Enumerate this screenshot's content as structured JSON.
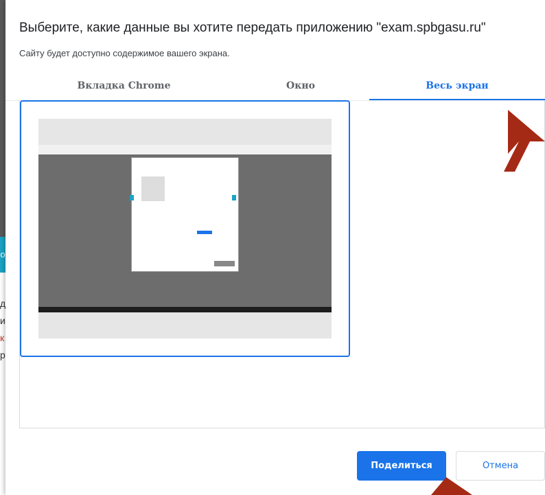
{
  "dialog": {
    "title": "Выберите, какие данные вы хотите передать приложению \"exam.spbgasu.ru\"",
    "subtitle": "Сайту будет доступно содержимое вашего экрана."
  },
  "tabs": [
    {
      "label": "Вкладка Chrome",
      "selected": false
    },
    {
      "label": "Окно",
      "selected": false
    },
    {
      "label": "Весь экран",
      "selected": true
    }
  ],
  "buttons": {
    "share": "Поделиться",
    "cancel": "Отмена"
  },
  "background": {
    "teal_char": "о",
    "chars": [
      "д",
      "и",
      "к",
      "р"
    ]
  },
  "colors": {
    "accent": "#1a73e8",
    "annotation_arrow": "#a52a16"
  },
  "icons": [
    "annotation-arrow-icon"
  ]
}
